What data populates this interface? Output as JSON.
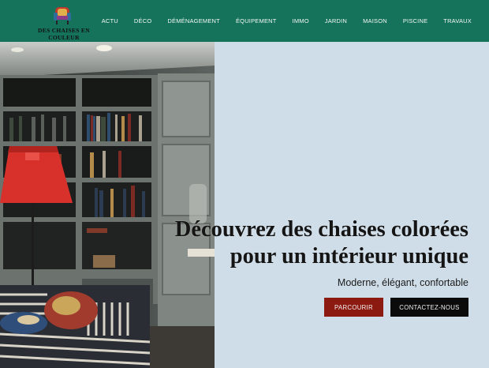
{
  "brand": {
    "name": "DES CHAISES EN COULEUR",
    "logo_icon": "armchair-icon"
  },
  "nav": {
    "items": [
      {
        "label": "ACTU"
      },
      {
        "label": "DÉCO"
      },
      {
        "label": "DÉMÉNAGEMENT"
      },
      {
        "label": "ÉQUIPEMENT"
      },
      {
        "label": "IMMO"
      },
      {
        "label": "JARDIN"
      },
      {
        "label": "MAISON"
      },
      {
        "label": "PISCINE"
      },
      {
        "label": "TRAVAUX"
      }
    ]
  },
  "hero": {
    "title_line1": "Découvrez des chaises colorées",
    "title_line2": "pour un intérieur unique",
    "subtitle": "Moderne, élégant, confortable",
    "browse_label": "PARCOURIR",
    "contact_label": "CONTACTEZ-NOUS"
  },
  "colors": {
    "header": "#15735c",
    "panel": "#cfdde8",
    "browse_button": "#8c1a10",
    "contact_button": "#0b0b0b",
    "lamp_shade": "#d8312c"
  }
}
